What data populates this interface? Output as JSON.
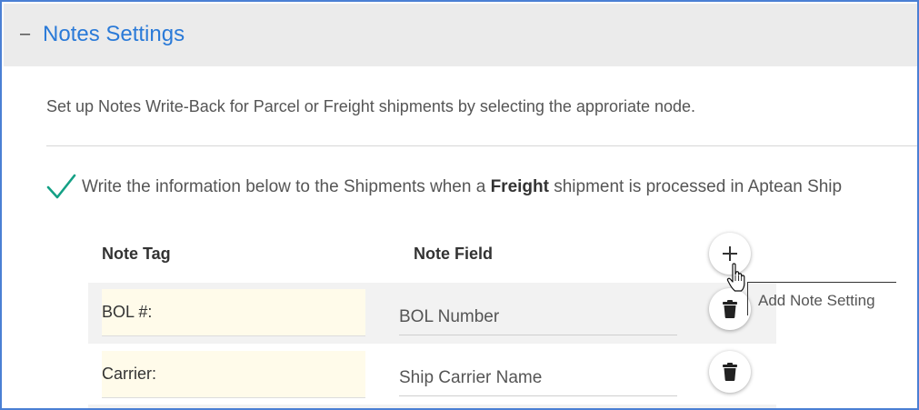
{
  "section": {
    "toggle": "–",
    "title": "Notes Settings"
  },
  "description": "Set up Notes Write-Back for Parcel or Freight shipments by selecting the approriate node.",
  "write_back": {
    "checked": true,
    "text_before": "Write the information below to the Shipments when a ",
    "emphasis": "Freight",
    "text_after": " shipment is processed in Aptean Ship"
  },
  "table": {
    "headers": {
      "tag": "Note Tag",
      "field": "Note Field"
    },
    "rows": [
      {
        "tag": "BOL #:",
        "field": "BOL Number"
      },
      {
        "tag": "Carrier:",
        "field": "Ship Carrier Name"
      }
    ]
  },
  "tooltip": "Add Note Setting",
  "icons": {
    "collapse": "minus-icon",
    "check": "checkmark-icon",
    "add": "plus-icon",
    "delete": "trash-icon",
    "cursor": "hand-pointer-icon"
  },
  "colors": {
    "title": "#2a7ad8",
    "check": "#14a085",
    "frame_border": "#4a7fd4",
    "tag_input_bg": "#fffbea"
  }
}
